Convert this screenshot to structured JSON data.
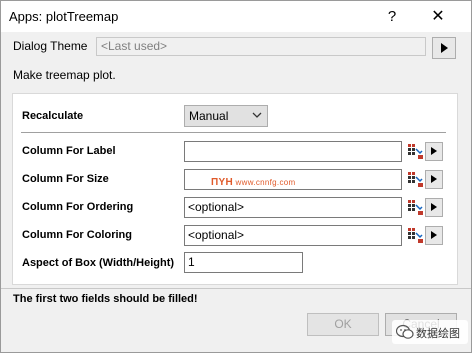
{
  "window": {
    "title": "Apps: plotTreemap",
    "help_glyph": "?",
    "close_glyph": "✕"
  },
  "theme": {
    "label": "Dialog Theme",
    "value": "<Last used>"
  },
  "description": "Make treemap plot.",
  "form": {
    "recalculate": {
      "label": "Recalculate",
      "value": "Manual"
    },
    "column_label": {
      "label": "Column For Label",
      "value": ""
    },
    "column_size": {
      "label": "Column For Size",
      "value": "",
      "overlay_logo": "ΠΥΗ",
      "overlay_url": "www.cnnfg.com"
    },
    "column_ordering": {
      "label": "Column For Ordering",
      "value": "<optional>"
    },
    "column_coloring": {
      "label": "Column For Coloring",
      "value": "<optional>"
    },
    "aspect": {
      "label": "Aspect of Box (Width/Height)",
      "value": "1"
    }
  },
  "status_message": "The first two fields should be filled!",
  "buttons": {
    "ok": "OK",
    "cancel": "Cancel"
  },
  "watermark": {
    "text": "数据绘图"
  },
  "colors": {
    "title_bg": "#ffffff",
    "dialog_bg": "#f0f0f0",
    "disabled_text": "#a0a0a0",
    "watermark_red": "#e05a2a"
  },
  "icons": [
    "help-icon",
    "close-icon",
    "theme-arrow-icon",
    "chevron-down-icon",
    "column-selector-icon",
    "arrow-right-icon",
    "wechat-icon"
  ]
}
